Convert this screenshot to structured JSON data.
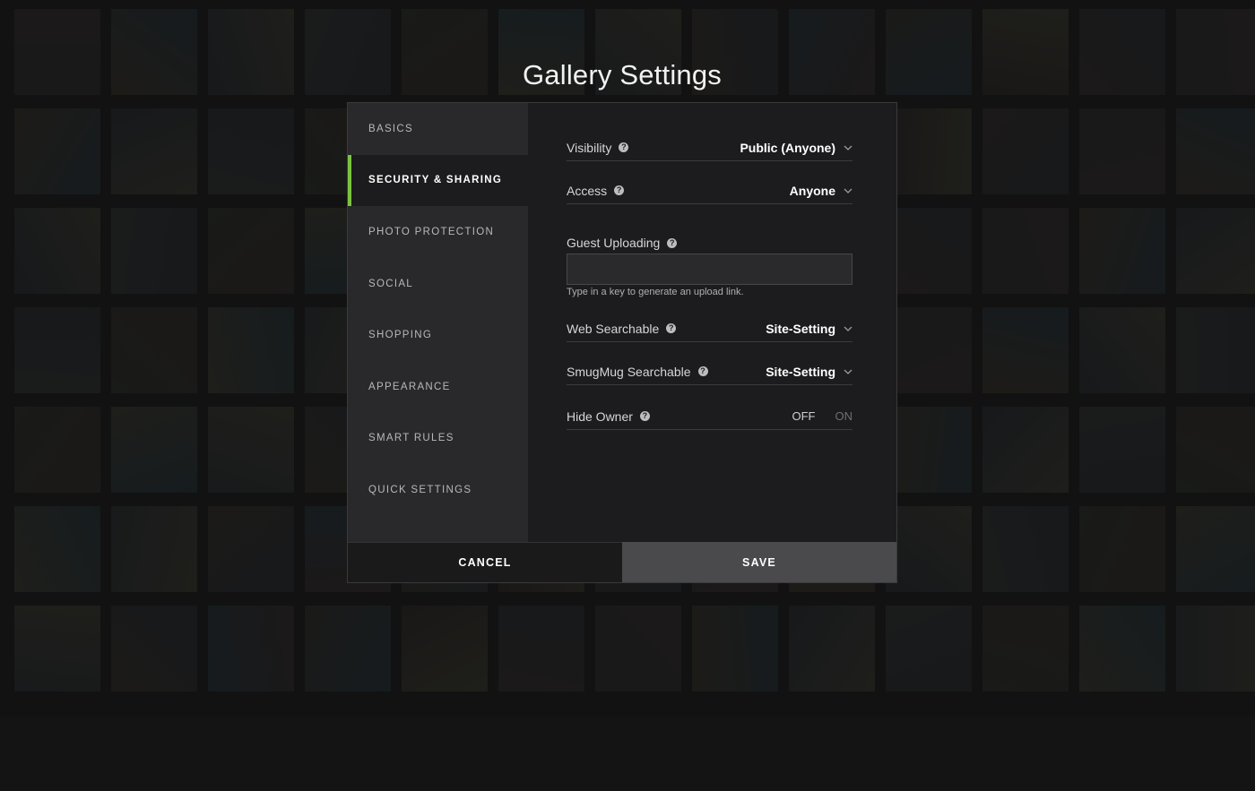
{
  "title": "Gallery Settings",
  "sidebar": {
    "items": [
      {
        "label": "BASICS",
        "active": false
      },
      {
        "label": "SECURITY & SHARING",
        "active": true
      },
      {
        "label": "PHOTO PROTECTION",
        "active": false
      },
      {
        "label": "SOCIAL",
        "active": false
      },
      {
        "label": "SHOPPING",
        "active": false
      },
      {
        "label": "APPEARANCE",
        "active": false
      },
      {
        "label": "SMART RULES",
        "active": false
      },
      {
        "label": "QUICK SETTINGS",
        "active": false
      }
    ]
  },
  "settings": {
    "visibility": {
      "label": "Visibility",
      "value": "Public (Anyone)"
    },
    "access": {
      "label": "Access",
      "value": "Anyone"
    },
    "guest_uploading": {
      "label": "Guest Uploading",
      "value": "",
      "hint": "Type in a key to generate an upload link."
    },
    "web_searchable": {
      "label": "Web Searchable",
      "value": "Site-Setting"
    },
    "smugmug_searchable": {
      "label": "SmugMug Searchable",
      "value": "Site-Setting"
    },
    "hide_owner": {
      "label": "Hide Owner",
      "off_label": "OFF",
      "on_label": "ON",
      "selected": "OFF"
    }
  },
  "help_glyph": "?",
  "footer": {
    "cancel_label": "CANCEL",
    "save_label": "SAVE"
  },
  "colors": {
    "accent": "#7bc242",
    "dialog_bg": "#1c1c1e",
    "sidebar_bg": "#29292c",
    "save_bg": "#4a4a4d"
  }
}
